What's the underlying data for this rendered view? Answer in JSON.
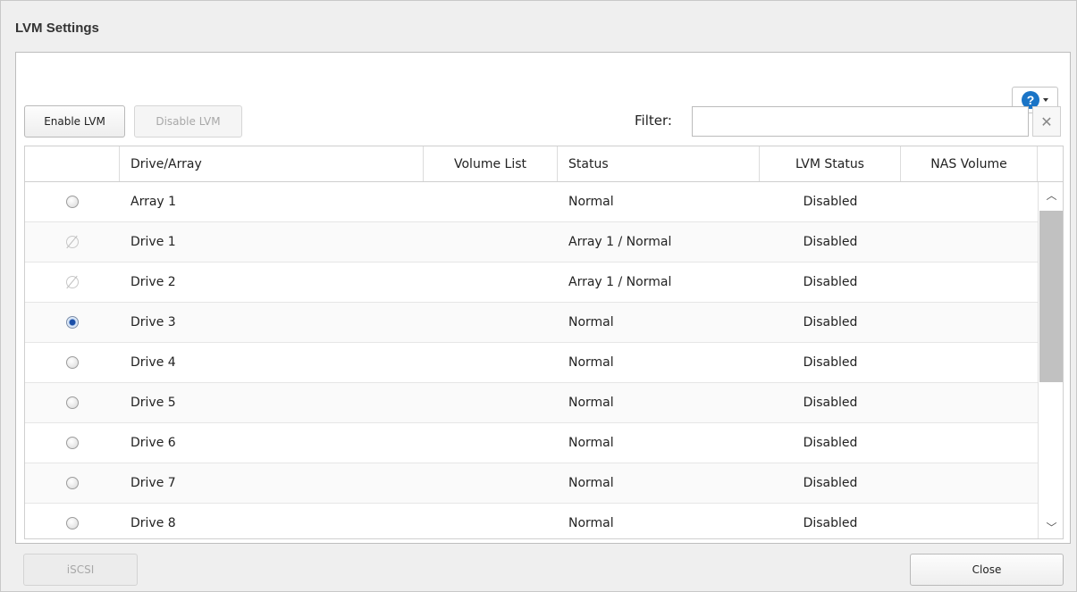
{
  "window": {
    "title": "LVM Settings"
  },
  "toolbar": {
    "enable_label": "Enable LVM",
    "disable_label": "Disable LVM",
    "help_icon": "question-circle-icon",
    "help_glyph": "?"
  },
  "filter": {
    "label": "Filter:",
    "value": "",
    "placeholder": "",
    "clear_glyph": "✕"
  },
  "table": {
    "columns": [
      "",
      "Drive/Array",
      "Volume List",
      "Status",
      "LVM Status",
      "NAS Volume"
    ],
    "rows": [
      {
        "selection": "unchecked",
        "drive": "Array 1",
        "volume_list": "",
        "status": "Normal",
        "lvm_status": "Disabled",
        "nas_volume": ""
      },
      {
        "selection": "unavailable",
        "drive": "Drive 1",
        "volume_list": "",
        "status": "Array 1 / Normal",
        "lvm_status": "Disabled",
        "nas_volume": ""
      },
      {
        "selection": "unavailable",
        "drive": "Drive 2",
        "volume_list": "",
        "status": "Array 1 / Normal",
        "lvm_status": "Disabled",
        "nas_volume": ""
      },
      {
        "selection": "checked",
        "drive": "Drive 3",
        "volume_list": "",
        "status": "Normal",
        "lvm_status": "Disabled",
        "nas_volume": ""
      },
      {
        "selection": "unchecked",
        "drive": "Drive 4",
        "volume_list": "",
        "status": "Normal",
        "lvm_status": "Disabled",
        "nas_volume": ""
      },
      {
        "selection": "unchecked",
        "drive": "Drive 5",
        "volume_list": "",
        "status": "Normal",
        "lvm_status": "Disabled",
        "nas_volume": ""
      },
      {
        "selection": "unchecked",
        "drive": "Drive 6",
        "volume_list": "",
        "status": "Normal",
        "lvm_status": "Disabled",
        "nas_volume": ""
      },
      {
        "selection": "unchecked",
        "drive": "Drive 7",
        "volume_list": "",
        "status": "Normal",
        "lvm_status": "Disabled",
        "nas_volume": ""
      },
      {
        "selection": "unchecked",
        "drive": "Drive 8",
        "volume_list": "",
        "status": "Normal",
        "lvm_status": "Disabled",
        "nas_volume": ""
      }
    ]
  },
  "scrollbar": {
    "up_glyph": "︿",
    "down_glyph": "﹀"
  },
  "footer": {
    "iscsi_label": "iSCSI",
    "close_label": "Close"
  },
  "colors": {
    "help_accent": "#1a74c6",
    "radio_checked": "#1a4fa8"
  }
}
